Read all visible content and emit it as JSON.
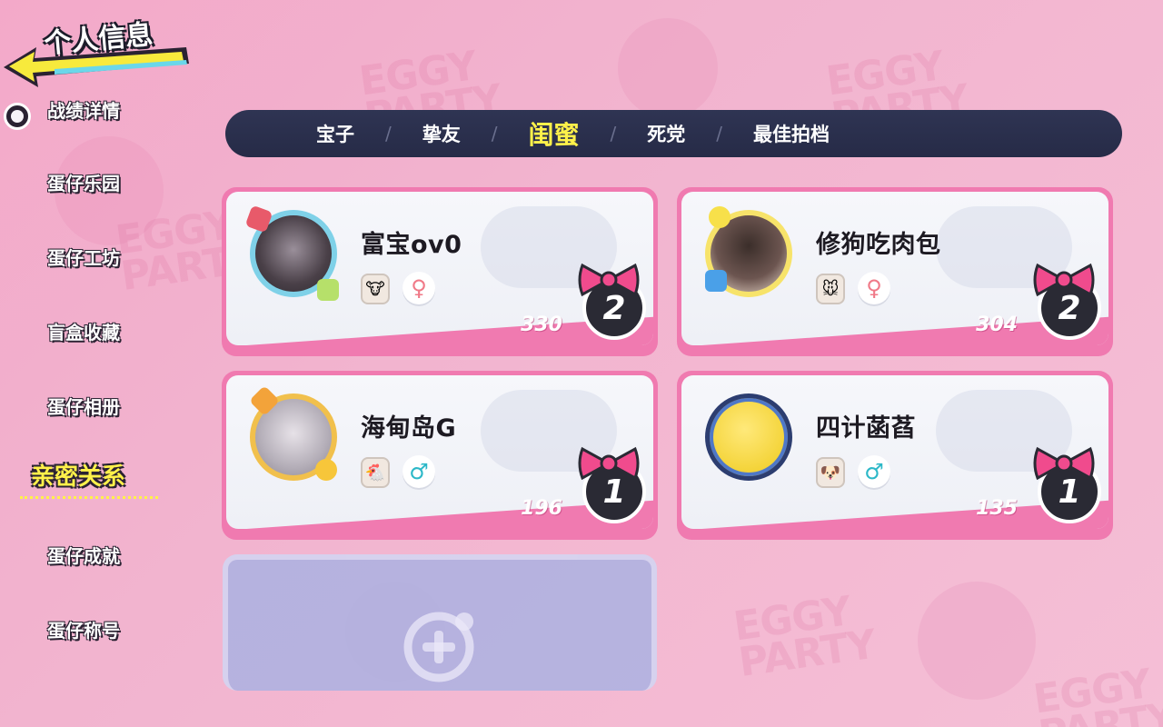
{
  "header": {
    "title": "个人信息"
  },
  "sidebar": {
    "items": [
      {
        "label": "战绩详情"
      },
      {
        "label": "蛋仔乐园"
      },
      {
        "label": "蛋仔工坊"
      },
      {
        "label": "盲盒收藏"
      },
      {
        "label": "蛋仔相册"
      },
      {
        "label": "亲密关系",
        "active": true
      },
      {
        "label": "蛋仔成就"
      },
      {
        "label": "蛋仔称号"
      }
    ]
  },
  "tabs": [
    {
      "label": "宝子"
    },
    {
      "label": "挚友"
    },
    {
      "label": "闺蜜",
      "active": true
    },
    {
      "label": "死党"
    },
    {
      "label": "最佳拍档"
    }
  ],
  "tab_separator": "/",
  "friends": [
    {
      "name": "富宝ov0",
      "gender": "female",
      "gender_symbol": "♀",
      "score": "330",
      "level": "2",
      "avatar": "avatar-blue-ring"
    },
    {
      "name": "修狗吃肉包",
      "gender": "female",
      "gender_symbol": "♀",
      "score": "304",
      "level": "2",
      "avatar": "avatar-pikachu"
    },
    {
      "name": "海甸岛G",
      "gender": "male",
      "gender_symbol": "♂",
      "score": "196",
      "level": "1",
      "avatar": "avatar-gold-frame"
    },
    {
      "name": "四计菡萏",
      "gender": "male",
      "gender_symbol": "♂",
      "score": "135",
      "level": "1",
      "avatar": "avatar-yellow-egg"
    }
  ],
  "background_watermark": [
    "EGGY",
    "PARTY"
  ],
  "colors": {
    "background": "#f2b4cf",
    "tab_bar": "#2a2f4c",
    "active_yellow": "#fff14a",
    "card_border": "#f07ab0",
    "female": "#f07a88",
    "male": "#2cb8c8"
  }
}
